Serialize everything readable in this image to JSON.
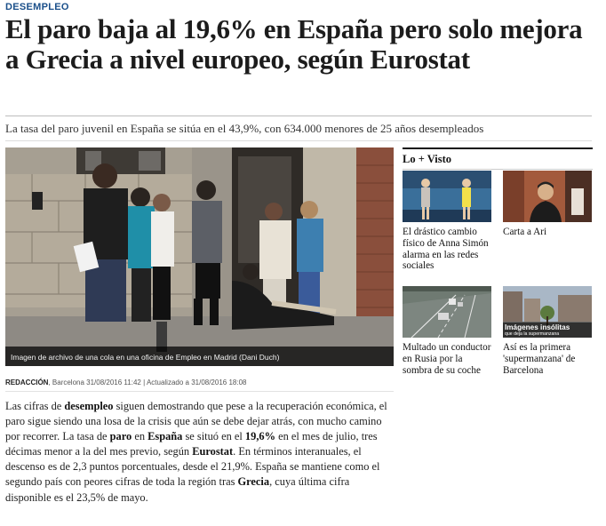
{
  "section": "DESEMPLEO",
  "headline": "El paro baja al 19,6% en España pero solo mejora a Grecia a nivel europeo, según Eurostat",
  "subheadline": "La tasa del paro juvenil en España se sitúa en el 43,9%, con 634.000 menores de 25 años desempleados",
  "hero": {
    "caption": "Imagen de archivo de una cola en una oficina de Empleo en Madrid (Dani Duch)"
  },
  "byline": {
    "author": "REDACCIÓN",
    "separator": ",",
    "published": " Barcelona 31/08/2016 11:42",
    "divider": " | ",
    "updated": "Actualizado a 31/08/2016 18:08"
  },
  "body": {
    "p1_a": "Las cifras de ",
    "p1_b": "desempleo",
    "p1_c": " siguen demostrando que pese a la recuperación económica, el paro sigue siendo una losa de la crisis que aún se debe dejar atrás, con mucho camino por recorrer. La tasa de ",
    "p1_d": "paro",
    "p1_e": " en ",
    "p1_f": "España",
    "p1_g": " se situó en el ",
    "p1_h": "19,6%",
    "p1_i": " en el mes de julio, tres décimas menor a la del mes previo, según ",
    "p1_j": "Eurostat",
    "p1_k": ". En términos interanuales, el descenso es de 2,3 puntos porcentuales, desde el 21,9%. España se mantiene como el segundo país con peores cifras de toda la región tras ",
    "p1_l": "Grecia",
    "p1_m": ", cuya última cifra disponible es el 23,5% de mayo."
  },
  "sidebar": {
    "title": "Lo + Visto",
    "items": [
      {
        "label": "El drástico cambio físico de Anna Simón alarma en las redes sociales"
      },
      {
        "label": "Carta a Ari"
      },
      {
        "label": "Multado un conductor en Rusia por la sombra de su coche"
      },
      {
        "label": "Así es la primera 'supermanzana' de Barcelona",
        "overlay_big": "Imágenes insólitas",
        "overlay_small": "que deja la supermanzana"
      }
    ]
  },
  "colors": {
    "section": "#1a4f8a",
    "headline": "#1c1c1c",
    "caption_bg": "#000000"
  }
}
